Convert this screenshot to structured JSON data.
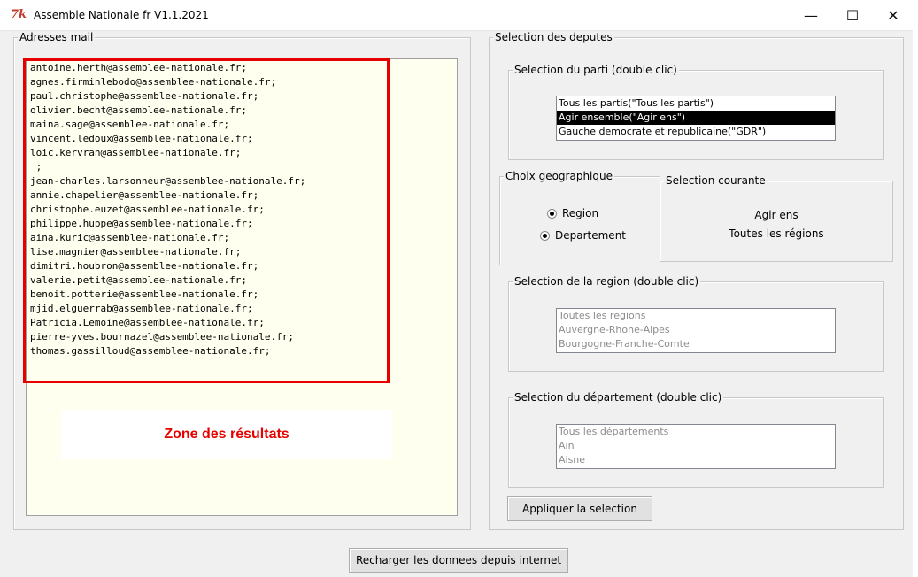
{
  "window": {
    "app_icon": "7k",
    "title": "Assemble Nationale fr V1.1.2021",
    "minimize": "—",
    "maximize": "☐",
    "close": "✕"
  },
  "adresses": {
    "label": "Adresses mail",
    "emails": [
      "antoine.herth@assemblee-nationale.fr;",
      "agnes.firminlebodo@assemblee-nationale.fr;",
      "paul.christophe@assemblee-nationale.fr;",
      "olivier.becht@assemblee-nationale.fr;",
      "maina.sage@assemblee-nationale.fr;",
      "vincent.ledoux@assemblee-nationale.fr;",
      "loic.kervran@assemblee-nationale.fr;",
      " ;",
      "jean-charles.larsonneur@assemblee-nationale.fr;",
      "annie.chapelier@assemblee-nationale.fr;",
      "christophe.euzet@assemblee-nationale.fr;",
      "philippe.huppe@assemblee-nationale.fr;",
      "aina.kuric@assemblee-nationale.fr;",
      "lise.magnier@assemblee-nationale.fr;",
      "dimitri.houbron@assemblee-nationale.fr;",
      "valerie.petit@assemblee-nationale.fr;",
      "benoit.potterie@assemblee-nationale.fr;",
      "mjid.elguerrab@assemblee-nationale.fr;",
      "Patricia.Lemoine@assemblee-nationale.fr;",
      "pierre-yves.bournazel@assemblee-nationale.fr;",
      "thomas.gassilloud@assemblee-nationale.fr;"
    ],
    "zone_label": "Zone des résultats",
    "highlight_color": "#e60000"
  },
  "deputes": {
    "label": "Selection des deputes",
    "parti": {
      "label": "Selection du parti (double clic)",
      "items": [
        "Tous les partis(\"Tous les partis\")",
        "Agir ensemble(\"Agir ens\")",
        "Gauche democrate et republicaine(\"GDR\")"
      ],
      "selected_index": 1
    },
    "geo": {
      "label": "Choix geographique",
      "region": "Region",
      "departement": "Departement"
    },
    "courante": {
      "label": "Selection courante",
      "parti": "Agir ens",
      "region": "Toutes les régions"
    },
    "region": {
      "label": "Selection de la region (double clic)",
      "items": [
        "Toutes les regions",
        "Auvergne-Rhone-Alpes",
        "Bourgogne-Franche-Comte"
      ]
    },
    "departement": {
      "label": "Selection du département (double clic)",
      "items": [
        "Tous les départements",
        "Ain",
        "Aisne"
      ]
    },
    "appliquer": "Appliquer la selection"
  },
  "recharger": "Recharger les donnees depuis internet"
}
